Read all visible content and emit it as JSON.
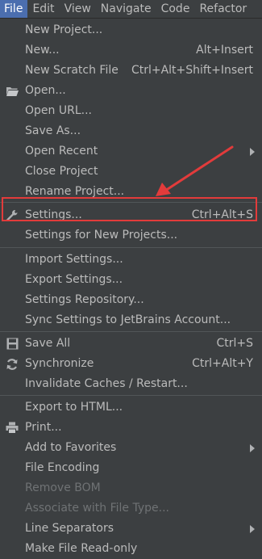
{
  "menubar": {
    "items": [
      "File",
      "Edit",
      "View",
      "Navigate",
      "Code",
      "Refactor"
    ]
  },
  "menu": {
    "items": [
      {
        "label": "New Project...",
        "shortcut": "",
        "icon": "",
        "submenu": false,
        "disabled": false
      },
      {
        "label": "New...",
        "shortcut": "Alt+Insert",
        "icon": "",
        "submenu": false,
        "disabled": false
      },
      {
        "label": "New Scratch File",
        "shortcut": "Ctrl+Alt+Shift+Insert",
        "icon": "",
        "submenu": false,
        "disabled": false
      },
      {
        "label": "Open...",
        "shortcut": "",
        "icon": "folder-open-icon",
        "submenu": false,
        "disabled": false
      },
      {
        "label": "Open URL...",
        "shortcut": "",
        "icon": "",
        "submenu": false,
        "disabled": false
      },
      {
        "label": "Save As...",
        "shortcut": "",
        "icon": "",
        "submenu": false,
        "disabled": false
      },
      {
        "label": "Open Recent",
        "shortcut": "",
        "icon": "",
        "submenu": true,
        "disabled": false
      },
      {
        "label": "Close Project",
        "shortcut": "",
        "icon": "",
        "submenu": false,
        "disabled": false
      },
      {
        "label": "Rename Project...",
        "shortcut": "",
        "icon": "",
        "submenu": false,
        "disabled": false
      },
      {
        "label": "Settings...",
        "shortcut": "Ctrl+Alt+S",
        "icon": "wrench-icon",
        "submenu": false,
        "disabled": false
      },
      {
        "label": "Settings for New Projects...",
        "shortcut": "",
        "icon": "",
        "submenu": false,
        "disabled": false
      },
      {
        "label": "Import Settings...",
        "shortcut": "",
        "icon": "",
        "submenu": false,
        "disabled": false
      },
      {
        "label": "Export Settings...",
        "shortcut": "",
        "icon": "",
        "submenu": false,
        "disabled": false
      },
      {
        "label": "Settings Repository...",
        "shortcut": "",
        "icon": "",
        "submenu": false,
        "disabled": false
      },
      {
        "label": "Sync Settings to JetBrains Account...",
        "shortcut": "",
        "icon": "",
        "submenu": false,
        "disabled": false
      },
      {
        "label": "Save All",
        "shortcut": "Ctrl+S",
        "icon": "save-icon",
        "submenu": false,
        "disabled": false
      },
      {
        "label": "Synchronize",
        "shortcut": "Ctrl+Alt+Y",
        "icon": "sync-icon",
        "submenu": false,
        "disabled": false
      },
      {
        "label": "Invalidate Caches / Restart...",
        "shortcut": "",
        "icon": "",
        "submenu": false,
        "disabled": false
      },
      {
        "label": "Export to HTML...",
        "shortcut": "",
        "icon": "",
        "submenu": false,
        "disabled": false
      },
      {
        "label": "Print...",
        "shortcut": "",
        "icon": "print-icon",
        "submenu": false,
        "disabled": false
      },
      {
        "label": "Add to Favorites",
        "shortcut": "",
        "icon": "",
        "submenu": true,
        "disabled": false
      },
      {
        "label": "File Encoding",
        "shortcut": "",
        "icon": "",
        "submenu": false,
        "disabled": false
      },
      {
        "label": "Remove BOM",
        "shortcut": "",
        "icon": "",
        "submenu": false,
        "disabled": true
      },
      {
        "label": "Associate with File Type...",
        "shortcut": "",
        "icon": "",
        "submenu": false,
        "disabled": true
      },
      {
        "label": "Line Separators",
        "shortcut": "",
        "icon": "",
        "submenu": true,
        "disabled": false
      },
      {
        "label": "Make File Read-only",
        "shortcut": "",
        "icon": "",
        "submenu": false,
        "disabled": false
      }
    ]
  },
  "colors": {
    "background": "#3c3f41",
    "active_menu": "#4b6eaf",
    "highlight_box": "#e23b3b",
    "text": "#bbbbbb",
    "disabled_text": "#6f7274"
  }
}
